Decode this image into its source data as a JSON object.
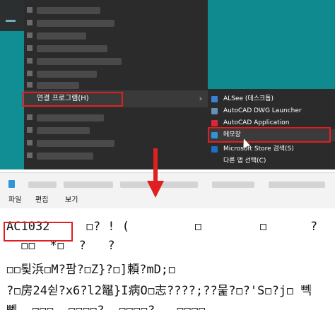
{
  "context_menu": {
    "open_with_label": "연결 프로그램(H)",
    "chevron": "›"
  },
  "submenu": {
    "items": [
      {
        "label": "ALSee (데스크톱)",
        "icon": "alsee-icon",
        "icon_color": "#3c7fd6"
      },
      {
        "label": "AutoCAD DWG Launcher",
        "icon": "autocad-dwg-icon",
        "icon_color": "#6a8fb8"
      },
      {
        "label": "AutoCAD Application",
        "icon": "autocad-app-icon",
        "icon_color": "#d8283a"
      },
      {
        "label": "메모장",
        "icon": "notepad-icon",
        "icon_color": "#2f95d6"
      },
      {
        "label": "Microsoft Store 검색(S)",
        "icon": "store-icon",
        "icon_color": "#1b6fc7"
      },
      {
        "label": "다른 앱 선택(C)",
        "icon": "",
        "icon_color": ""
      }
    ]
  },
  "notepad": {
    "menu": [
      "파일",
      "편집",
      "보기"
    ],
    "lines": [
      "AC1032     ◻? ! (         ◻        ◻      ?",
      "  ◻◻  *◻  ?   ?",
      "◻◻툋浜◻M?팜?◻Z}?◻]頼?mD;◻",
      "?◻房24쉳?x6?l2䵹}I病O◻志????;??뭁?◻?'S◻?j◻ 뻭",
      "뻭  ◻◻◻  ◻◻◻◻?  ◻◻◻◻?   ◻◻◻◻"
    ]
  },
  "colors": {
    "highlight_box": "#e02020",
    "desktop_teal": "#0f8a8f",
    "menu_bg": "#2b2b2b"
  }
}
